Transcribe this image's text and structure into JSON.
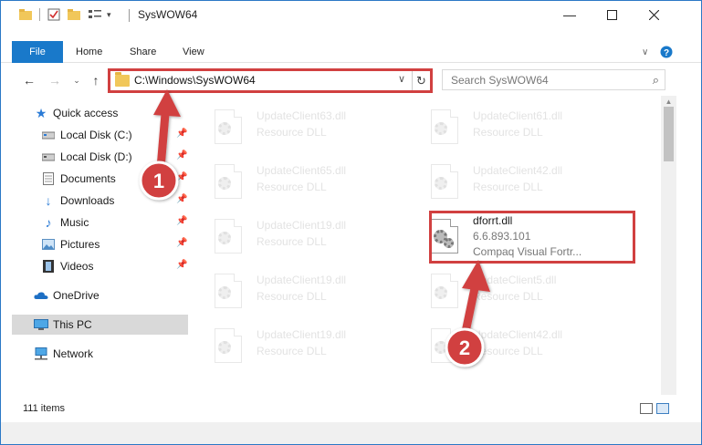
{
  "window": {
    "title": "SysWOW64"
  },
  "ribbon": {
    "tabs": [
      "File",
      "Home",
      "Share",
      "View"
    ]
  },
  "address": {
    "path": "C:\\Windows\\SysWOW64"
  },
  "search": {
    "placeholder": "Search SysWOW64"
  },
  "sidebar": {
    "items": [
      {
        "label": "Quick access",
        "icon": "star-icon",
        "pinned": false
      },
      {
        "label": "Local Disk (C:)",
        "icon": "disk-icon",
        "pinned": true
      },
      {
        "label": "Local Disk (D:)",
        "icon": "disk-icon",
        "pinned": true
      },
      {
        "label": "Documents",
        "icon": "documents-icon",
        "pinned": true
      },
      {
        "label": "Downloads",
        "icon": "download-icon",
        "pinned": true
      },
      {
        "label": "Music",
        "icon": "music-icon",
        "pinned": true
      },
      {
        "label": "Pictures",
        "icon": "pictures-icon",
        "pinned": true
      },
      {
        "label": "Videos",
        "icon": "videos-icon",
        "pinned": true
      },
      {
        "label": "OneDrive",
        "icon": "cloud-icon",
        "pinned": false
      },
      {
        "label": "This PC",
        "icon": "computer-icon",
        "pinned": false,
        "selected": true
      },
      {
        "label": "Network",
        "icon": "network-icon",
        "pinned": false
      }
    ]
  },
  "files": [
    {
      "name": "UpdateClient63.dll",
      "desc": "Resource DLL"
    },
    {
      "name": "UpdateClient61.dll",
      "desc": "Resource DLL"
    },
    {
      "name": "UpdateClient65.dll",
      "desc": "Resource DLL"
    },
    {
      "name": "UpdateClient42.dll",
      "desc": "Resource DLL"
    },
    {
      "name": "UpdateClient19.dll",
      "desc": "Resource DLL"
    },
    {
      "name": "dforrt.dll",
      "version": "6.6.893.101",
      "desc": "Compaq Visual Fortr..."
    },
    {
      "name": "UpdateClient19.dll",
      "desc": "Resource DLL"
    },
    {
      "name": "UpdateClient5.dll",
      "desc": "Resource DLL"
    },
    {
      "name": "UpdateClient19.dll",
      "desc": "Resource DLL"
    },
    {
      "name": "UpdateClient42.dll",
      "desc": "Resource DLL"
    }
  ],
  "status": {
    "item_count": "111 items"
  },
  "annotations": {
    "step1": "1",
    "step2": "2",
    "color": "#d14040"
  }
}
